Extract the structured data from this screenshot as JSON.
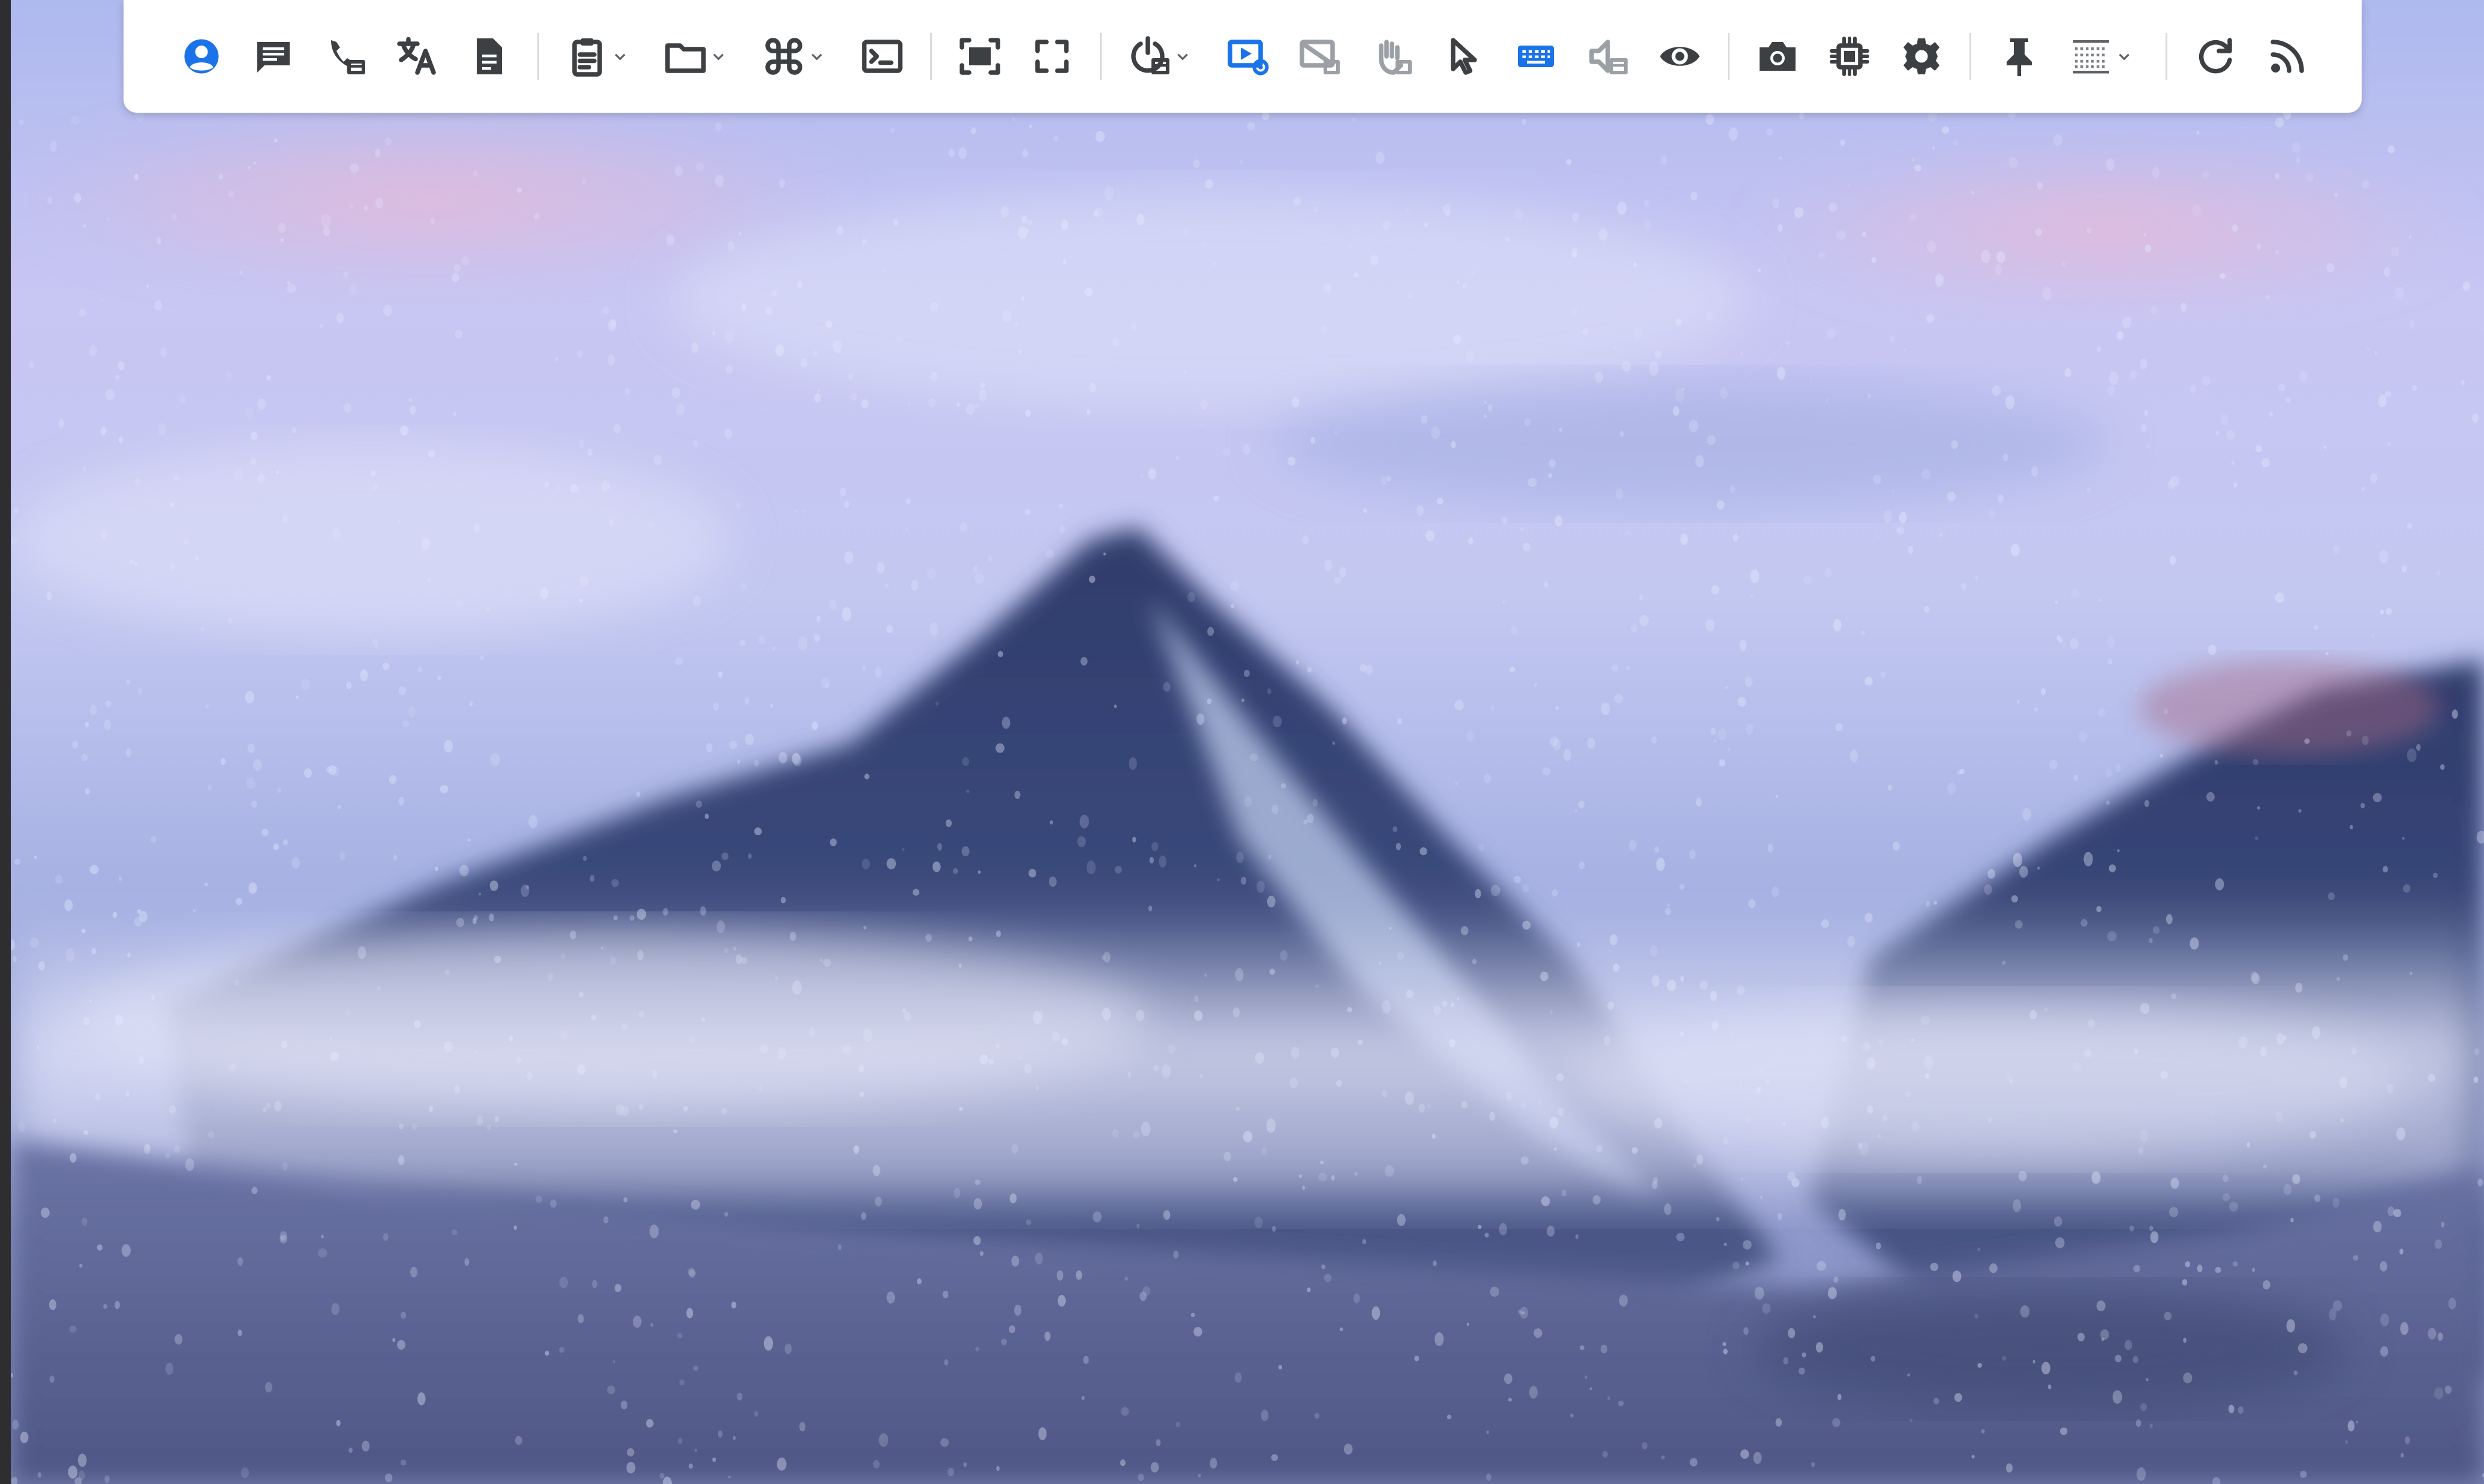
{
  "window": {
    "title": ""
  },
  "colors": {
    "toolbar_bg": "#ffffff",
    "icon_default": "#3c4043",
    "icon_active": "#1a73e8",
    "icon_disabled": "#9aa0a6",
    "sky_top": "#b7c0ef",
    "mountain_dark": "#34416e"
  },
  "toolbar": {
    "groups": [
      {
        "items": [
          {
            "icon": "user-circle-icon",
            "state": "active"
          },
          {
            "icon": "chat-icon",
            "state": "default"
          },
          {
            "icon": "voice-call-icon",
            "state": "default"
          },
          {
            "icon": "translate-icon",
            "state": "default"
          },
          {
            "icon": "document-icon",
            "state": "default"
          }
        ]
      },
      {
        "items": [
          {
            "icon": "clipboard-icon",
            "state": "default",
            "dropdown": true
          },
          {
            "icon": "folder-icon",
            "state": "default",
            "dropdown": true
          },
          {
            "icon": "command-key-icon",
            "state": "default",
            "dropdown": true
          },
          {
            "icon": "terminal-icon",
            "state": "default"
          }
        ]
      },
      {
        "items": [
          {
            "icon": "fit-screen-icon",
            "state": "default"
          },
          {
            "icon": "fullscreen-icon",
            "state": "default"
          }
        ]
      },
      {
        "items": [
          {
            "icon": "power-action-icon",
            "state": "default",
            "dropdown": true
          },
          {
            "icon": "screen-settings-icon",
            "state": "active"
          },
          {
            "icon": "display-switch-icon",
            "state": "disabled"
          },
          {
            "icon": "block-input-icon",
            "state": "disabled"
          },
          {
            "icon": "cursor-icon",
            "state": "default"
          },
          {
            "icon": "keyboard-icon",
            "state": "active"
          },
          {
            "icon": "audio-icon",
            "state": "disabled"
          },
          {
            "icon": "eye-icon",
            "state": "default"
          }
        ]
      },
      {
        "items": [
          {
            "icon": "camera-icon",
            "state": "default"
          },
          {
            "icon": "chip-icon",
            "state": "default"
          },
          {
            "icon": "gear-icon",
            "state": "default"
          }
        ]
      },
      {
        "items": [
          {
            "icon": "pin-icon",
            "state": "default"
          },
          {
            "icon": "grid-quality-icon",
            "state": "default",
            "dropdown": true
          }
        ]
      },
      {
        "items": [
          {
            "icon": "refresh-icon",
            "state": "default"
          },
          {
            "icon": "rss-icon",
            "state": "default"
          }
        ]
      }
    ]
  },
  "desktop": {
    "wallpaper": "rain-on-glass-mountain"
  }
}
